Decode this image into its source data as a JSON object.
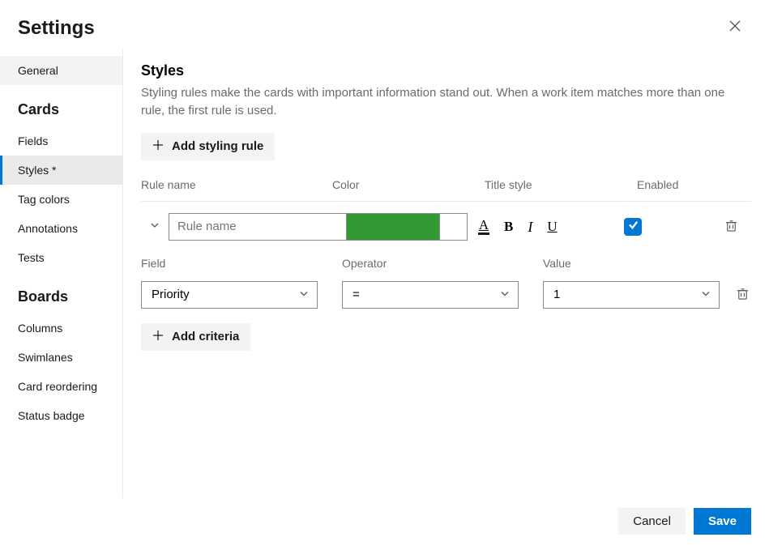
{
  "header": {
    "title": "Settings"
  },
  "sidebar": {
    "general": "General",
    "groups": {
      "cards": {
        "title": "Cards",
        "items": [
          "Fields",
          "Styles *",
          "Tag colors",
          "Annotations",
          "Tests"
        ]
      },
      "boards": {
        "title": "Boards",
        "items": [
          "Columns",
          "Swimlanes",
          "Card reordering",
          "Status badge"
        ]
      }
    }
  },
  "main": {
    "title": "Styles",
    "description": "Styling rules make the cards with important information stand out. When a work item matches more than one rule, the first rule is used.",
    "add_rule_label": "Add styling rule",
    "columns": {
      "rule_name": "Rule name",
      "color": "Color",
      "title_style": "Title style",
      "enabled": "Enabled"
    },
    "rule": {
      "name_placeholder": "Rule name",
      "color_value": "#339933",
      "enabled": true
    },
    "criteria_columns": {
      "field": "Field",
      "operator": "Operator",
      "value": "Value"
    },
    "criteria": {
      "field": "Priority",
      "operator": "=",
      "value": "1"
    },
    "add_criteria_label": "Add criteria"
  },
  "footer": {
    "cancel": "Cancel",
    "save": "Save"
  }
}
